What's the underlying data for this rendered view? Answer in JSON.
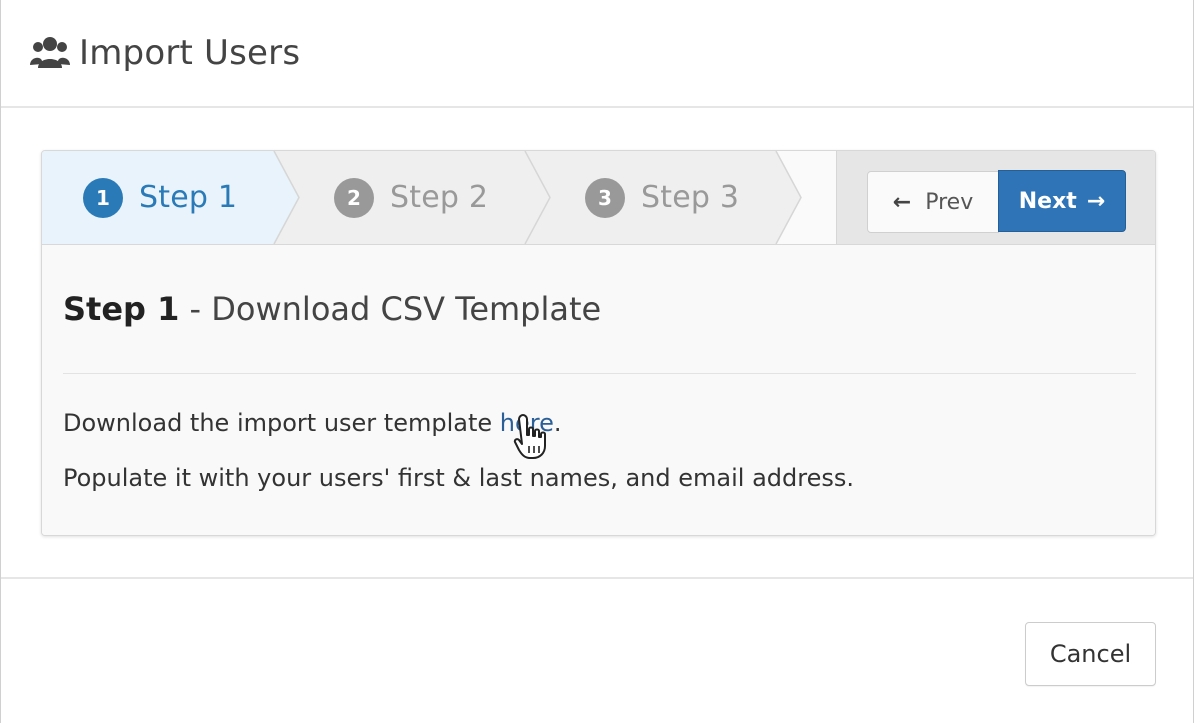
{
  "modal": {
    "title": "Import Users",
    "title_icon": "users-icon"
  },
  "wizard": {
    "steps": [
      {
        "number": "1",
        "label": "Step 1",
        "state": "active"
      },
      {
        "number": "2",
        "label": "Step 2",
        "state": "inactive"
      },
      {
        "number": "3",
        "label": "Step 3",
        "state": "inactive"
      }
    ],
    "prev_label": "Prev",
    "next_label": "Next",
    "prev_icon": "arrow-left-icon",
    "next_icon": "arrow-right-icon",
    "colors": {
      "active": "#2a7ab8",
      "inactive": "#999999",
      "primary_button": "#2f74b7"
    }
  },
  "content": {
    "heading_strong": "Step 1",
    "heading_rest": " - Download CSV Template",
    "para1_before": "Download the import user template ",
    "para1_link": "here",
    "para1_after": ".",
    "para2": "Populate it with your users' first & last names, and email address."
  },
  "footer": {
    "cancel_label": "Cancel"
  },
  "cursor": "hand-pointer-icon"
}
